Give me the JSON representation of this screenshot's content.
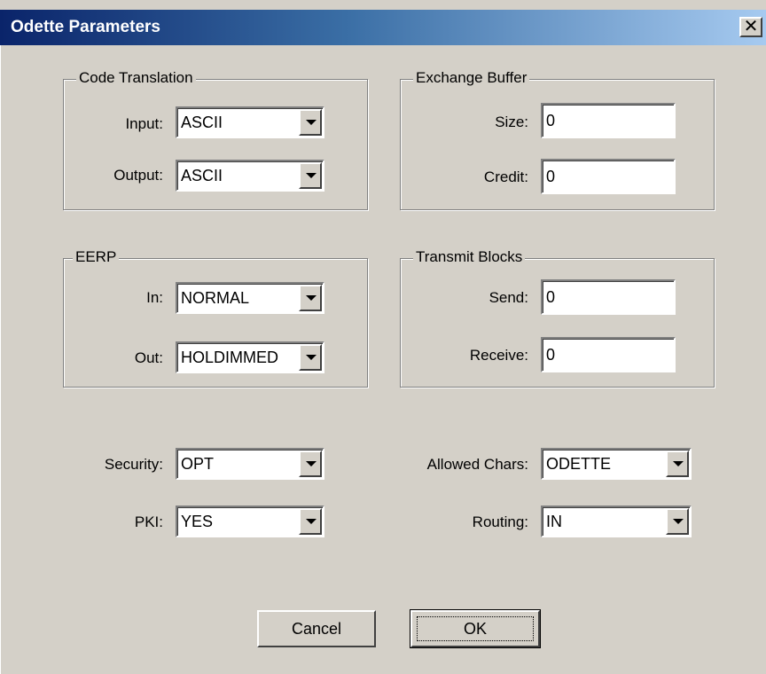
{
  "window": {
    "title": "Odette Parameters",
    "close_glyph": "✕"
  },
  "code_translation": {
    "legend": "Code Translation",
    "input_label": "Input:",
    "input_value": "ASCII",
    "output_label": "Output:",
    "output_value": "ASCII"
  },
  "exchange_buffer": {
    "legend": "Exchange Buffer",
    "size_label": "Size:",
    "size_value": "0",
    "credit_label": "Credit:",
    "credit_value": "0"
  },
  "eerp": {
    "legend": "EERP",
    "in_label": "In:",
    "in_value": "NORMAL",
    "out_label": "Out:",
    "out_value": "HOLDIMMED"
  },
  "transmit_blocks": {
    "legend": "Transmit Blocks",
    "send_label": "Send:",
    "send_value": "0",
    "receive_label": "Receive:",
    "receive_value": "0"
  },
  "misc": {
    "security_label": "Security:",
    "security_value": "OPT",
    "pki_label": "PKI:",
    "pki_value": "YES",
    "allowed_chars_label": "Allowed Chars:",
    "allowed_chars_value": "ODETTE",
    "routing_label": "Routing:",
    "routing_value": "IN"
  },
  "buttons": {
    "cancel": "Cancel",
    "ok": "OK"
  },
  "icons": {
    "dropdown": "chevron-down-icon",
    "close": "close-icon"
  },
  "colors": {
    "dialog_bg": "#d4d0c8",
    "title_start": "#0a246a",
    "title_end": "#a6caf0"
  }
}
